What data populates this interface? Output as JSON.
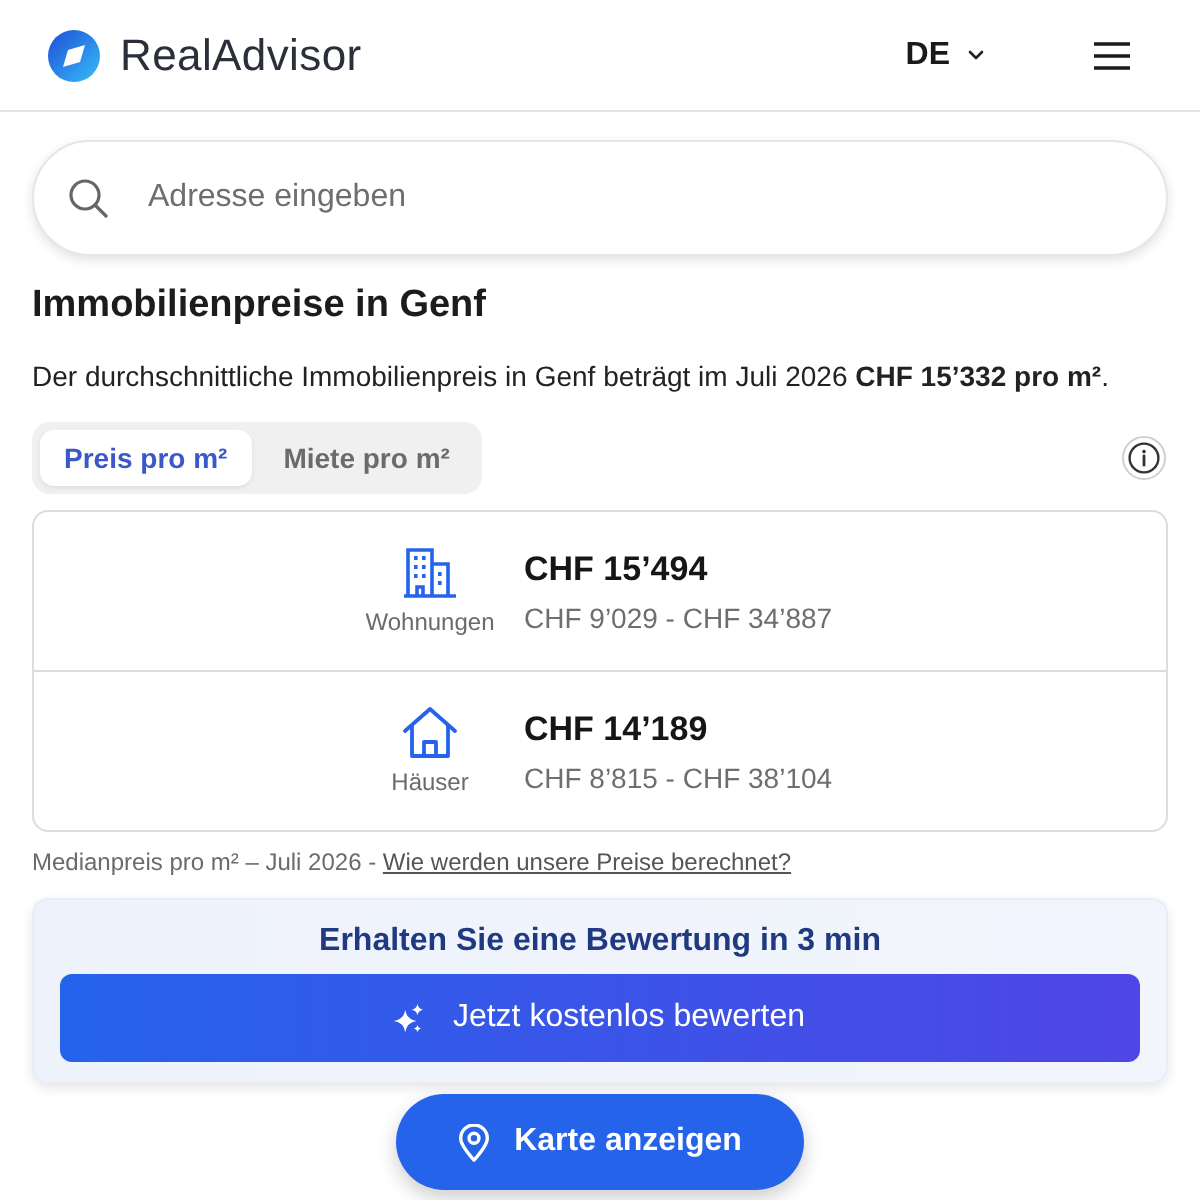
{
  "header": {
    "logo_text": "RealAdvisor",
    "language": "DE"
  },
  "search": {
    "placeholder": "Adresse eingeben"
  },
  "title": "Immobilienpreise in Genf",
  "summary": "Der durchschnittliche Immobilienpreis in Genf beträgt im Juli 2026 **CHF 15’332 pro m²**.",
  "tabs": [
    {
      "label": "Preis pro m²",
      "selected": true
    },
    {
      "label": "Miete pro m²",
      "selected": false
    }
  ],
  "prices": [
    {
      "kind": "apartment",
      "label": "Wohnungen",
      "price": "CHF 15’494",
      "range": "CHF 9’029 - CHF 34’887"
    },
    {
      "kind": "house",
      "label": "Häuser",
      "price": "CHF 14’189",
      "range": "CHF 8’815 - CHF 38’104"
    }
  ],
  "note": {
    "text": "Medianpreis pro m² – Juli 2026 -",
    "link": "Wie werden unsere Preise berechnet?"
  },
  "cta": {
    "title": "Erhalten Sie eine Bewertung in 3 min",
    "button": "Jetzt kostenlos bewerten"
  },
  "map_button": "Karte anzeigen"
}
